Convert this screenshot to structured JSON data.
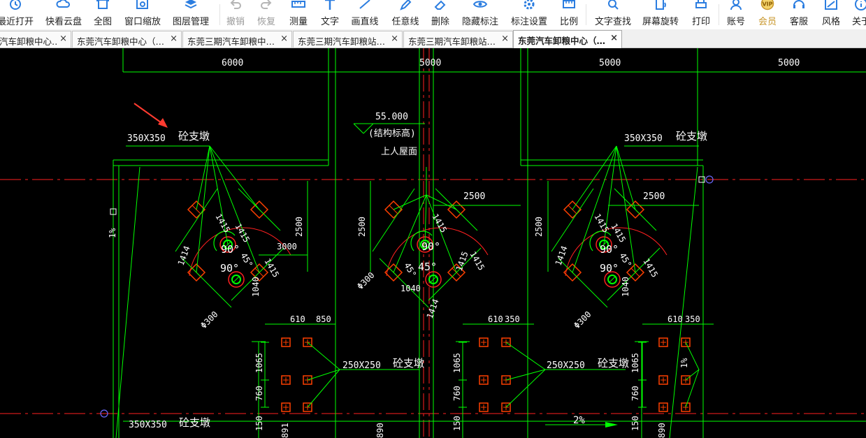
{
  "toolbar": {
    "items": [
      {
        "label": "最近打开",
        "icon": "clock-icon"
      },
      {
        "label": "快看云盘",
        "icon": "cloud-icon"
      },
      {
        "label": "全图",
        "icon": "fit-view-icon"
      },
      {
        "label": "窗口缩放",
        "icon": "zoom-window-icon"
      },
      {
        "label": "图层管理",
        "icon": "layers-icon"
      },
      {
        "label": "撤销",
        "icon": "undo-icon",
        "disabled": true
      },
      {
        "label": "恢复",
        "icon": "redo-icon",
        "disabled": true
      },
      {
        "label": "测量",
        "icon": "ruler-icon"
      },
      {
        "label": "文字",
        "icon": "text-icon"
      },
      {
        "label": "画直线",
        "icon": "line-icon"
      },
      {
        "label": "任意线",
        "icon": "pen-icon"
      },
      {
        "label": "删除",
        "icon": "eraser-icon"
      },
      {
        "label": "隐藏标注",
        "icon": "eye-icon"
      },
      {
        "label": "标注设置",
        "icon": "settings-icon"
      },
      {
        "label": "比例",
        "icon": "scale-icon"
      },
      {
        "label": "文字查找",
        "icon": "text-search-icon"
      },
      {
        "label": "屏幕旋转",
        "icon": "rotate-icon"
      },
      {
        "label": "打印",
        "icon": "printer-icon"
      },
      {
        "label": "账号",
        "icon": "user-icon"
      },
      {
        "label": "会员",
        "icon": "vip-icon",
        "vip_text": "VIP"
      },
      {
        "label": "客服",
        "icon": "headset-icon"
      },
      {
        "label": "风格",
        "icon": "style-icon"
      },
      {
        "label": "关于",
        "icon": "info-icon"
      }
    ],
    "accent_color": "#2b7de0",
    "vip_color": "#c8962a"
  },
  "tabs": [
    {
      "label": "汽车卸粮中心…",
      "active": false
    },
    {
      "label": "东莞汽车卸粮中心（…",
      "active": false
    },
    {
      "label": "东莞三期汽车卸粮中…",
      "active": false
    },
    {
      "label": "东莞三期汽车卸粮站…",
      "active": false
    },
    {
      "label": "东莞三期汽车卸粮站…",
      "active": false
    },
    {
      "label": "东莞汽车卸粮中心（…",
      "active": true
    }
  ],
  "tab_close_glyph": "×",
  "drawing": {
    "background": "#000000",
    "colors": {
      "line": "#00ff00",
      "axis": "#ff0000",
      "dim_text": "#ffffff",
      "label_text": "#ffffff",
      "hatch": "#ff4000",
      "annotation_arrow": "#ff3b30"
    },
    "top_dimensions": [
      "6000",
      "5000",
      "5000",
      "5000"
    ],
    "elevation": {
      "value": "55.000",
      "note": "(结构标高)",
      "desc": "上人屋面"
    },
    "pier_labels": {
      "large_size": "350X350",
      "small_size": "250X250",
      "name": "砼支墩"
    },
    "detail_dims": {
      "d2500": "2500",
      "d3000": "3000",
      "d1414": "1414",
      "d1415": "1415",
      "d1040": "1040",
      "d610": "610",
      "d850": "850",
      "d350": "350",
      "d1065": "1065",
      "d760": "760",
      "d150": "150",
      "d891": "891",
      "d890": "890",
      "angle90": "90°",
      "angle45": "45°",
      "phi300": "Φ300",
      "slope1": "1%",
      "slope2": "2%"
    }
  }
}
